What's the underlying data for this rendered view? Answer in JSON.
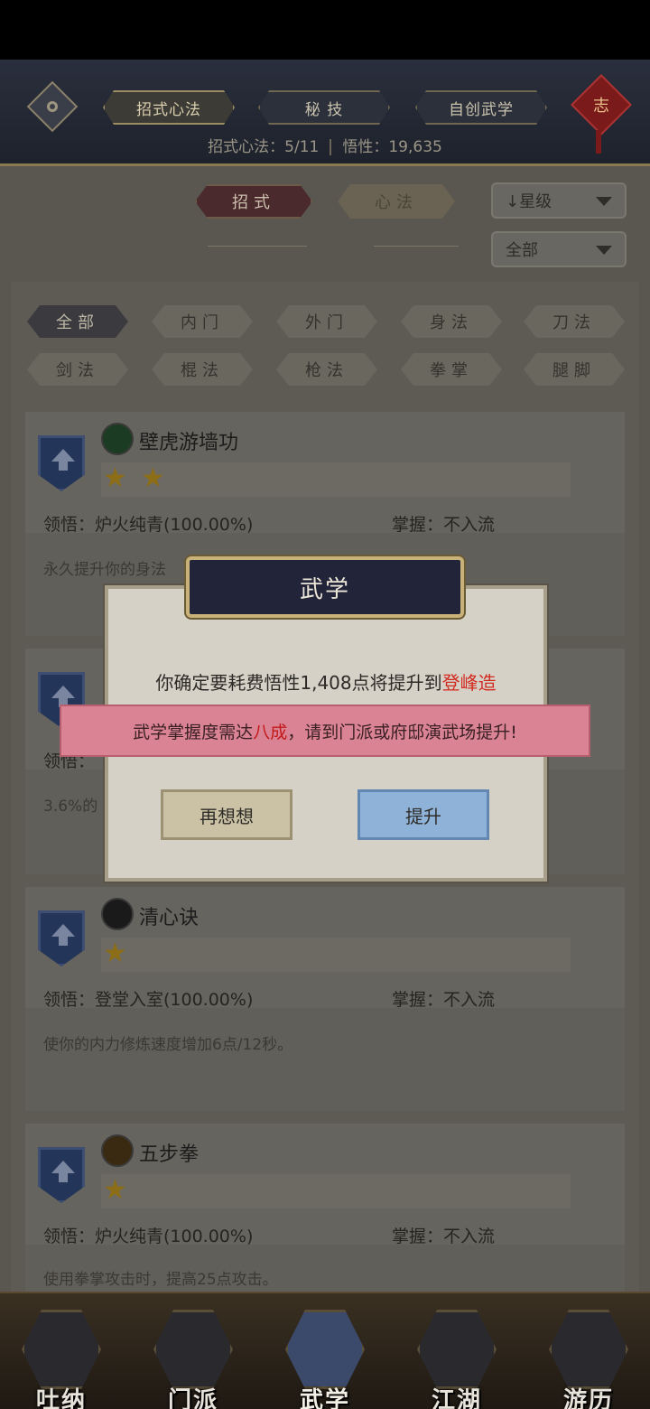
{
  "header": {
    "tabs": [
      {
        "label": "招式心法",
        "active": true
      },
      {
        "label": "秘 技",
        "active": false
      },
      {
        "label": "自创武学",
        "active": false
      }
    ],
    "knot_char": "志",
    "stats": {
      "moves": "招式心法：5/11",
      "insight": "悟性：19,635"
    }
  },
  "filters": {
    "mode_tabs": [
      {
        "label": "招式",
        "active": true
      },
      {
        "label": "心法",
        "active": false
      }
    ],
    "sort_select": "↓星级",
    "scope_select": "全部"
  },
  "categories": [
    "全部",
    "内门",
    "外门",
    "身法",
    "刀法",
    "剑法",
    "棍法",
    "枪法",
    "拳掌",
    "腿脚"
  ],
  "skills": [
    {
      "name": "壁虎游墙功",
      "stars": 2,
      "comprehension": "领悟：炉火纯青(100.00%)",
      "mastery": "掌握：不入流",
      "desc": "永久提升你的身法"
    },
    {
      "name": "",
      "stars": 0,
      "comprehension": "领悟：",
      "mastery": "",
      "desc": "3.6%的"
    },
    {
      "name": "清心诀",
      "stars": 1,
      "comprehension": "领悟：登堂入室(100.00%)",
      "mastery": "掌握：不入流",
      "desc": "使你的内力修炼速度增加6点/12秒。"
    },
    {
      "name": "五步拳",
      "stars": 1,
      "comprehension": "领悟：炉火纯青(100.00%)",
      "mastery": "掌握：不入流",
      "desc": "使用拳掌攻击时，提高25点攻击。"
    }
  ],
  "modal": {
    "title": "武学",
    "message_prefix": "你确定要耗费悟性1,408点将提升到",
    "message_highlight": "登峰造",
    "cancel_label": "再想想",
    "confirm_label": "提升"
  },
  "toast": {
    "prefix": "武学掌握度需达",
    "highlight": "八成",
    "suffix": "，请到门派或府邸演武场提升!"
  },
  "bottom_nav": [
    {
      "label": "吐纳",
      "active": false
    },
    {
      "label": "门派",
      "active": false
    },
    {
      "label": "武学",
      "active": true
    },
    {
      "label": "江湖",
      "active": false
    },
    {
      "label": "游历",
      "active": false
    }
  ],
  "colors": {
    "highlight_red": "#d22a1f",
    "confirm_blue": "#8fb2d8",
    "cancel_tan": "#cbc2a6"
  }
}
